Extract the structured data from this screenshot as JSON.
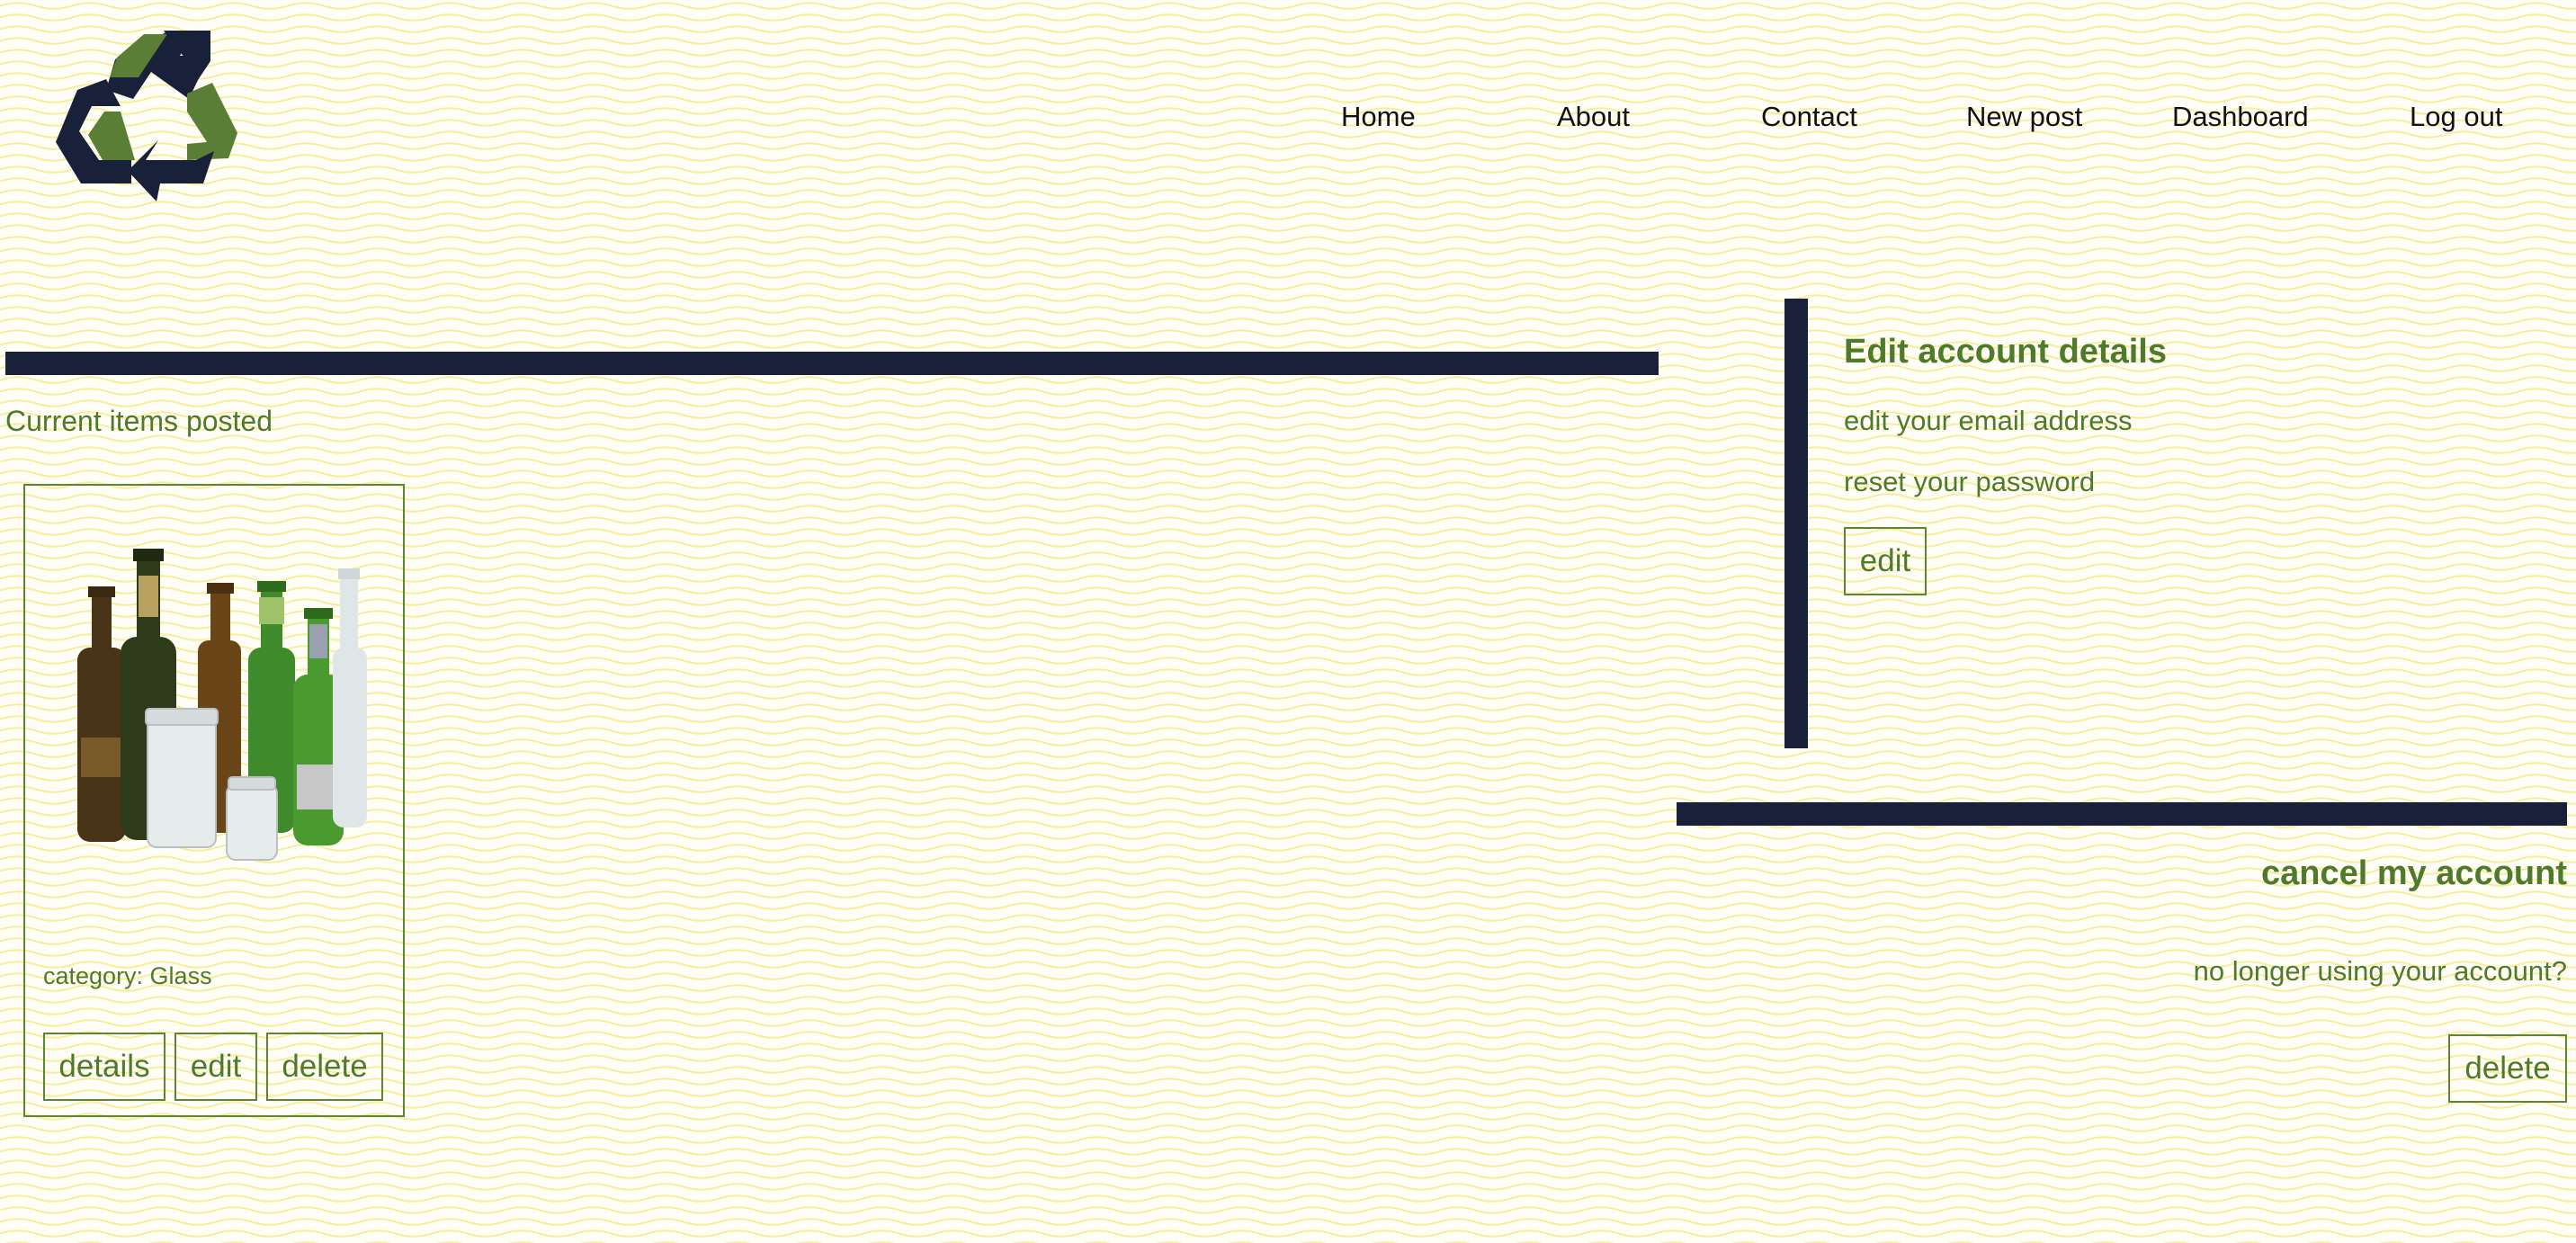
{
  "colors": {
    "accent_green": "#4f7a2c",
    "navy": "#19203a",
    "wave_pattern": "#f6ee9a",
    "background": "#fffef6"
  },
  "header": {
    "logo_icon": "recycle-icon",
    "nav": {
      "home": "Home",
      "about": "About",
      "contact": "Contact",
      "new_post": "New post",
      "dashboard": "Dashboard",
      "log_out": "Log out"
    }
  },
  "items": {
    "section_label": "Current items posted",
    "cards": [
      {
        "image": "glass-bottles-image",
        "category": "category: Glass",
        "details_label": "details",
        "edit_label": "edit",
        "delete_label": "delete"
      }
    ]
  },
  "account": {
    "edit_title": "Edit account details",
    "edit_email": "edit your email address",
    "reset_password": "reset your password",
    "edit_label": "edit",
    "cancel_title": "cancel my account",
    "cancel_text": "no longer using your account?",
    "delete_label": "delete"
  }
}
